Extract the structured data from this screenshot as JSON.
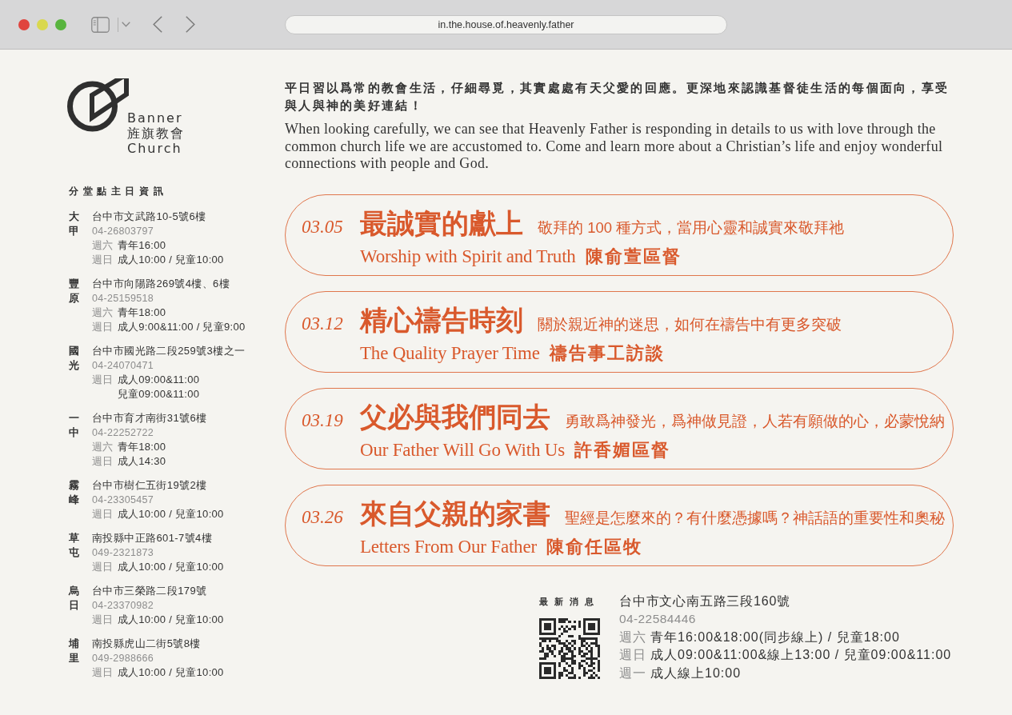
{
  "browser": {
    "url": "in.the.house.of.heavenly.father"
  },
  "logo": {
    "lines": [
      "Banner",
      "旌旗教會",
      "Church"
    ]
  },
  "sidebar": {
    "title": "分堂點主日資訊",
    "branches": [
      {
        "name": "大甲",
        "address": "台中市文武路10-5號6樓",
        "phone": "04-26803797",
        "schedule": [
          {
            "day": "週六",
            "text": "青年16:00"
          },
          {
            "day": "週日",
            "text": "成人10:00 / 兒童10:00"
          }
        ]
      },
      {
        "name": "豐原",
        "address": "台中市向陽路269號4樓、6樓",
        "phone": "04-25159518",
        "schedule": [
          {
            "day": "週六",
            "text": "青年18:00"
          },
          {
            "day": "週日",
            "text": "成人9:00&11:00 / 兒童9:00"
          }
        ]
      },
      {
        "name": "國光",
        "address": "台中市國光路二段259號3樓之一",
        "phone": "04-24070471",
        "schedule": [
          {
            "day": "週日",
            "text": "成人09:00&11:00"
          },
          {
            "text": "兒童09:00&11:00"
          }
        ]
      },
      {
        "name": "一中",
        "address": "台中市育才南街31號6樓",
        "phone": "04-22252722",
        "schedule": [
          {
            "day": "週六",
            "text": "青年18:00"
          },
          {
            "day": "週日",
            "text": "成人14:30"
          }
        ]
      },
      {
        "name": "霧峰",
        "address": "台中市樹仁五街19號2樓",
        "phone": "04-23305457",
        "schedule": [
          {
            "day": "週日",
            "text": "成人10:00 / 兒童10:00"
          }
        ]
      },
      {
        "name": "草屯",
        "address": "南投縣中正路601-7號4樓",
        "phone": "049-2321873",
        "schedule": [
          {
            "day": "週日",
            "text": "成人10:00 / 兒童10:00"
          }
        ]
      },
      {
        "name": "烏日",
        "address": "台中市三榮路二段179號",
        "phone": "04-23370982",
        "schedule": [
          {
            "day": "週日",
            "text": "成人10:00 / 兒童10:00"
          }
        ]
      },
      {
        "name": "埔里",
        "address": "南投縣虎山二街5號8樓",
        "phone": "049-2988666",
        "schedule": [
          {
            "day": "週日",
            "text": "成人10:00 / 兒童10:00"
          }
        ]
      }
    ]
  },
  "intro": {
    "chinese": "平日習以爲常的教會生活，仔細尋覓，其實處處有天父愛的回應。更深地來認識基督徒生活的每個面向，享受與人與神的美好連結！",
    "english": "When looking carefully, we can see that Heavenly Father is responding in details to us with love through the common church life we are accustomed to. Come and learn more about a Christian’s life and enjoy wonderful connections with people and God."
  },
  "events": [
    {
      "date": "03.05",
      "title": "最誠實的獻上",
      "subtitle": "敬拜的 100 種方式，當用心靈和誠實來敬拜祂",
      "english_title": "Worship with Spirit and Truth",
      "speaker": "陳俞萱區督"
    },
    {
      "date": "03.12",
      "title": "精心禱告時刻",
      "subtitle": "關於親近神的迷思，如何在禱告中有更多突破",
      "english_title": "The Quality Prayer Time",
      "speaker": "禱告事工訪談"
    },
    {
      "date": "03.19",
      "title": "父必與我們同去",
      "subtitle": "勇敢爲神發光，爲神做見證，人若有願做的心，必蒙悅納",
      "english_title": "Our Father Will Go With Us",
      "speaker": "許香媚區督"
    },
    {
      "date": "03.26",
      "title": "來自父親的家書",
      "subtitle": "聖經是怎麼來的？有什麼憑據嗎？神話語的重要性和奧秘",
      "english_title": "Letters From Our Father",
      "speaker": "陳俞任區牧"
    }
  ],
  "news": {
    "title": "最新消息",
    "address": "台中市文心南五路三段160號",
    "phone": "04-22584446",
    "schedule": [
      {
        "day": "週六",
        "text": "青年16:00&18:00(同步線上) / 兒童18:00"
      },
      {
        "day": "週日",
        "text": "成人09:00&11:00&線上13:00 / 兒童09:00&11:00"
      },
      {
        "day": "週一",
        "text": "成人線上10:00"
      }
    ]
  }
}
